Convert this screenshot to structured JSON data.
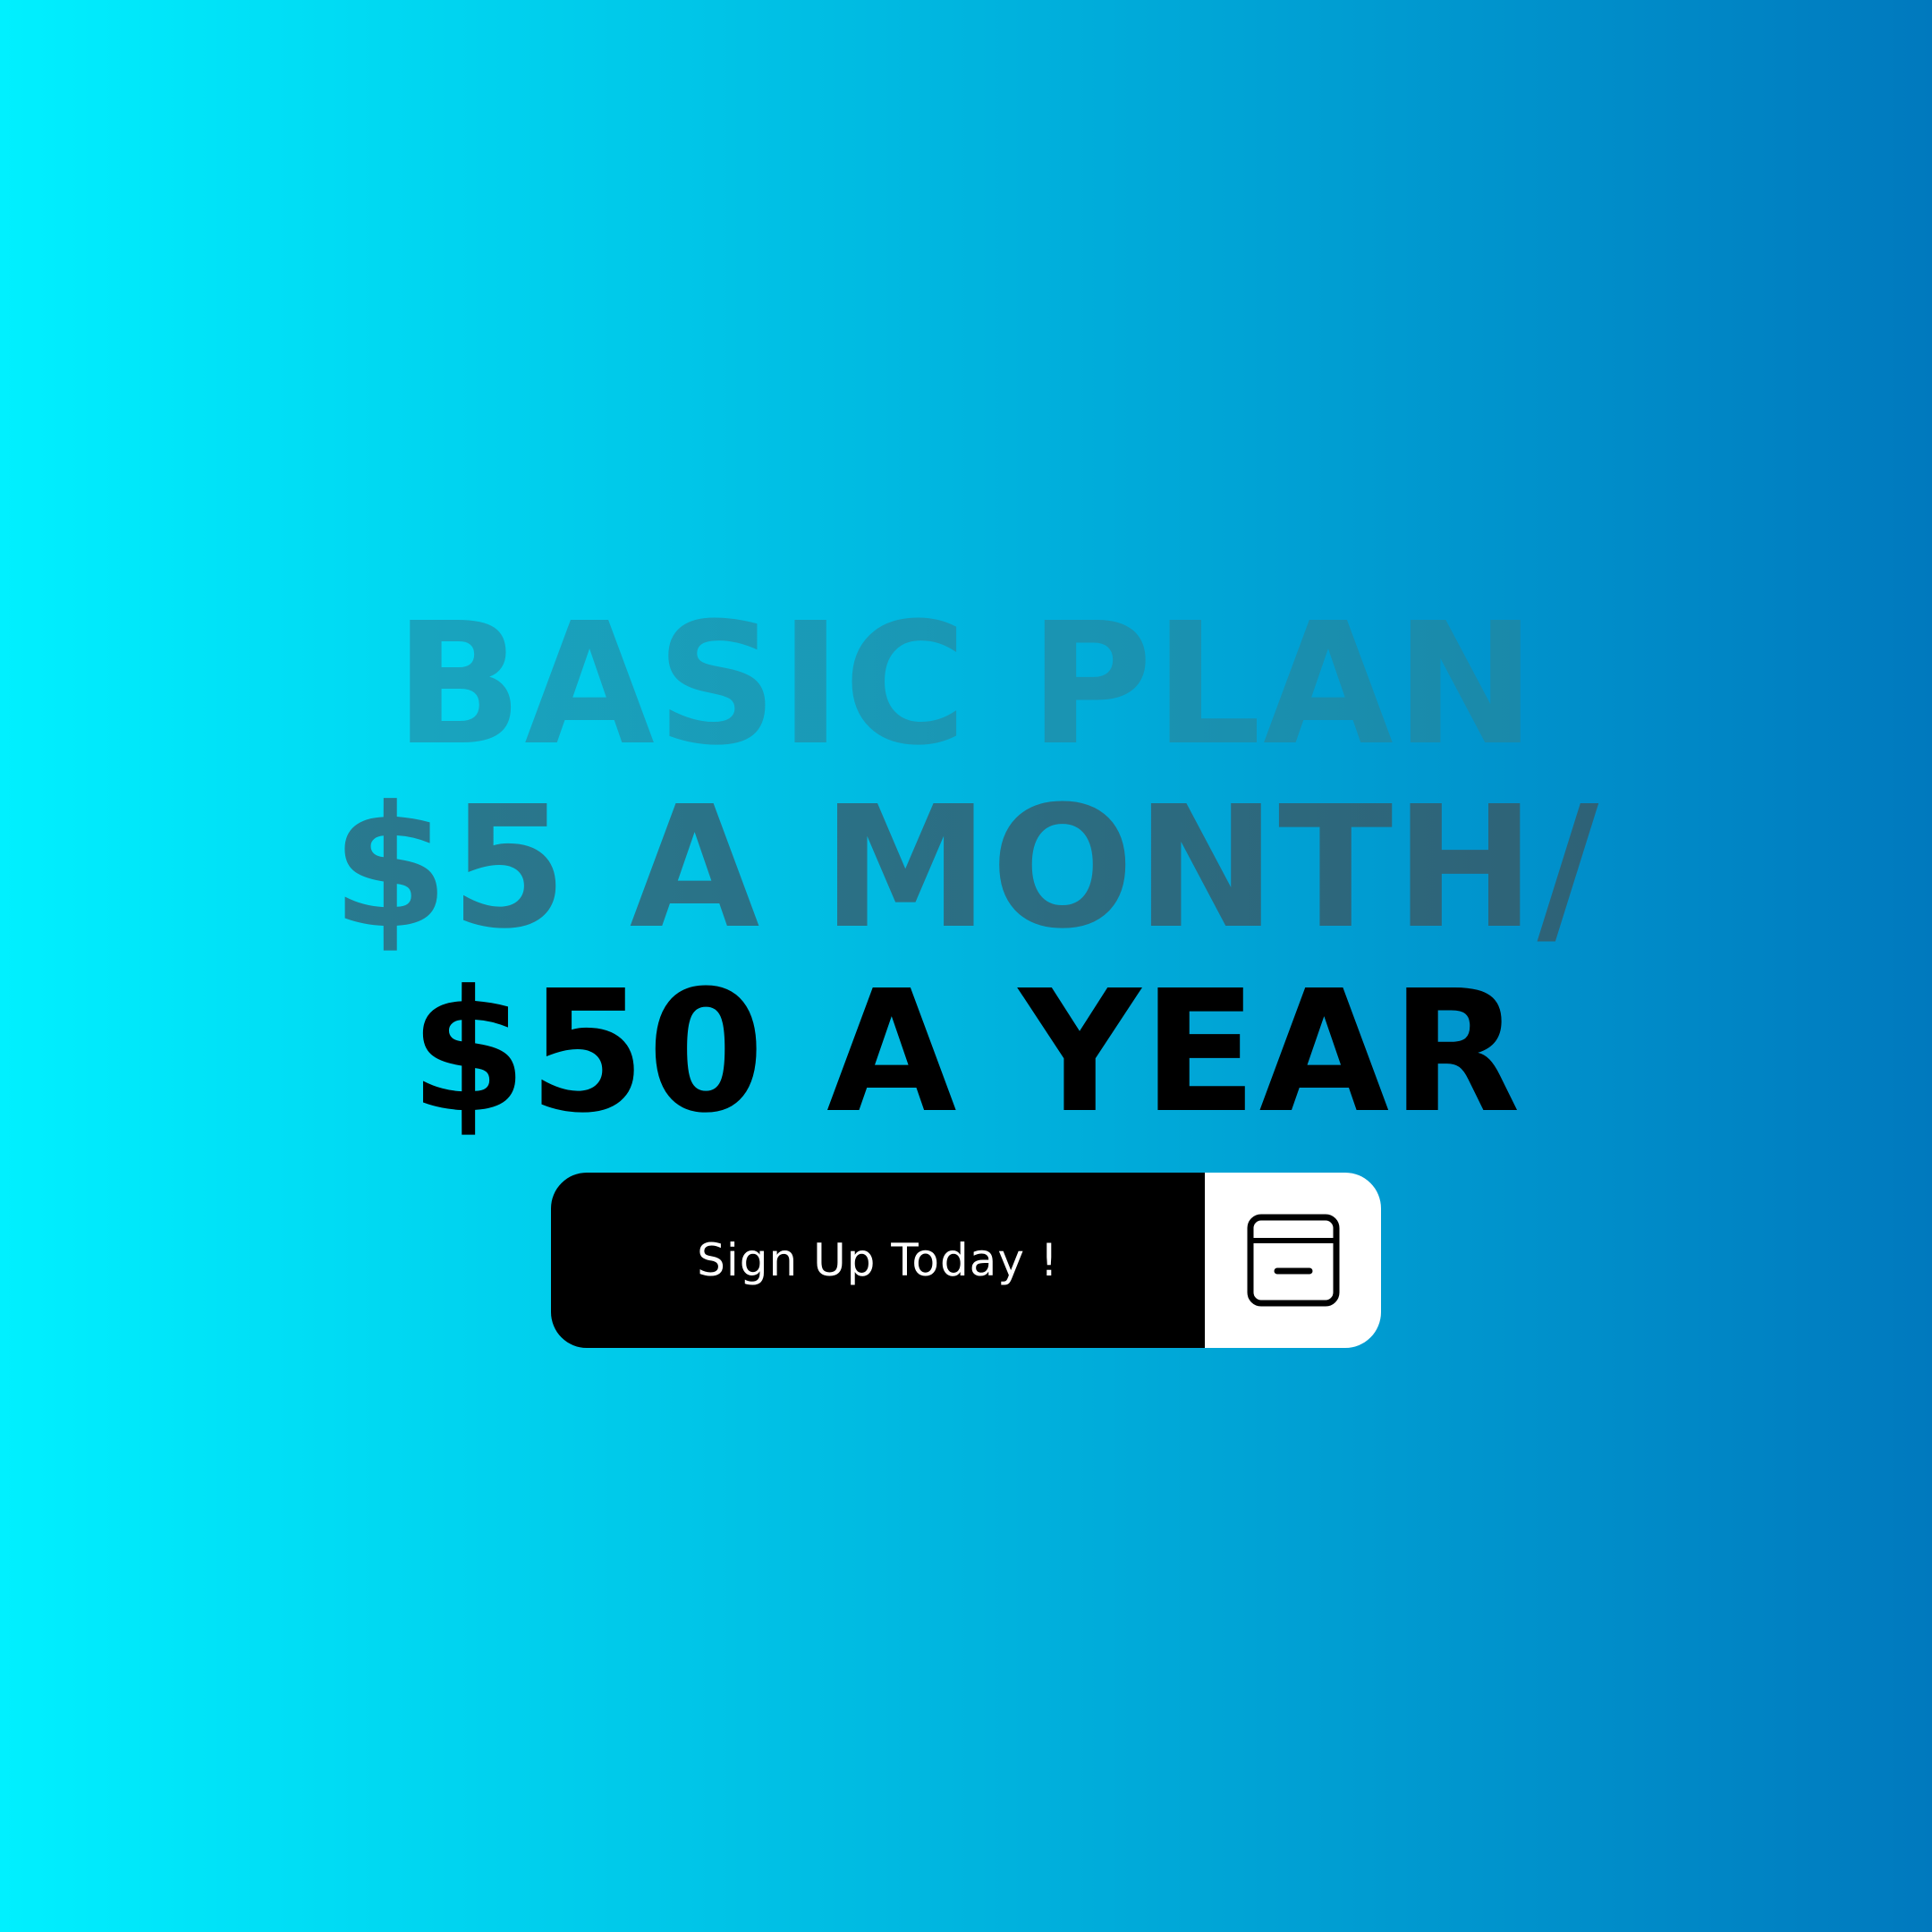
{
  "background": {
    "gradient_start": "#00F0FF",
    "gradient_end": "#0079BE"
  },
  "headline": {
    "line1": {
      "text": "BASIC PLAN",
      "color_start": "#19AEC6",
      "color_end": "#1A7FA2"
    },
    "line2": {
      "text": "$5 A MONTH/",
      "color_start": "#278096",
      "color_end": "#305C70"
    },
    "line3": {
      "text": "$50 A YEAR",
      "color": "#000000"
    }
  },
  "cta": {
    "label": "Sign Up Today !",
    "label_bg": "#000000",
    "label_color": "#FFFFFF",
    "icon": "payment-card-icon",
    "icon_bg": "#FFFFFF"
  }
}
